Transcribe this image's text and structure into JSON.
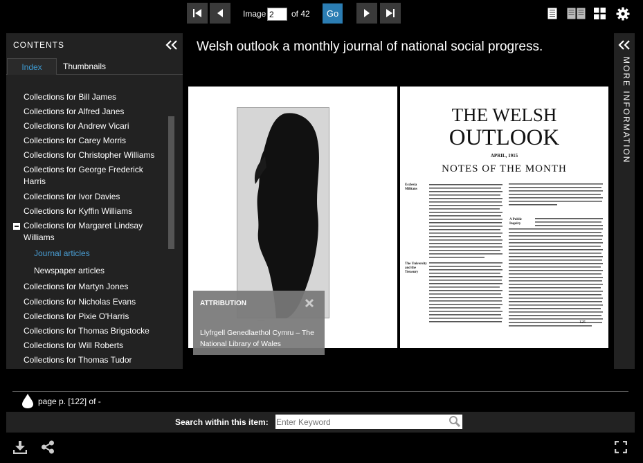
{
  "toolbar": {
    "image_label": "Image",
    "current_image": "2",
    "of_label": "of 42",
    "go_label": "Go"
  },
  "sidebar": {
    "title": "CONTENTS",
    "tabs": [
      {
        "label": "Index",
        "active": true
      },
      {
        "label": "Thumbnails",
        "active": false
      }
    ],
    "items": [
      {
        "label": "Collections for Bill James"
      },
      {
        "label": "Collections for Alfred Janes"
      },
      {
        "label": "Collections for Andrew Vicari"
      },
      {
        "label": "Collections for Carey Morris"
      },
      {
        "label": "Collections for Christopher Williams"
      },
      {
        "label": "Collections for George Frederick",
        "label2": "Harris"
      },
      {
        "label": "Collections for Ivor Davies"
      },
      {
        "label": "Collections for Kyffin Williams"
      },
      {
        "label": "Collections for Margaret Lindsay",
        "label2": "Williams"
      },
      {
        "label": "Journal articles"
      },
      {
        "label": "Newspaper articles"
      },
      {
        "label": "Collections for Martyn Jones"
      },
      {
        "label": "Collections for Nicholas Evans"
      },
      {
        "label": "Collections for Pixie O'Harris"
      },
      {
        "label": "Collections for Thomas Brigstocke"
      },
      {
        "label": "Collections for Will Roberts"
      },
      {
        "label": "Collections for Thomas Tudor"
      }
    ]
  },
  "main": {
    "title": "Welsh outlook a monthly journal of national social progress."
  },
  "page_right": {
    "title_line1": "THE WELSH",
    "title_line2": "OUTLOOK",
    "date": "APRIL, 1915",
    "section": "NOTES OF THE MONTH",
    "page_number": "125",
    "side_heads": [
      "Ecclesia Militans",
      "A Public Inquiry",
      "The University and the Treasury"
    ]
  },
  "attribution": {
    "title": "ATTRIBUTION",
    "text": "Llyfrgell Genedlaethol Cymru – The National Library of Wales"
  },
  "more_info": {
    "label": "MORE INFORMATION"
  },
  "footer": {
    "page_info": "page p. [122] of -",
    "search_label": "Search within this item:",
    "search_placeholder": "Enter Keyword"
  },
  "colors": {
    "accent": "#2b7db3",
    "active_link": "#4a9fd6",
    "panel_bg": "#222222"
  }
}
